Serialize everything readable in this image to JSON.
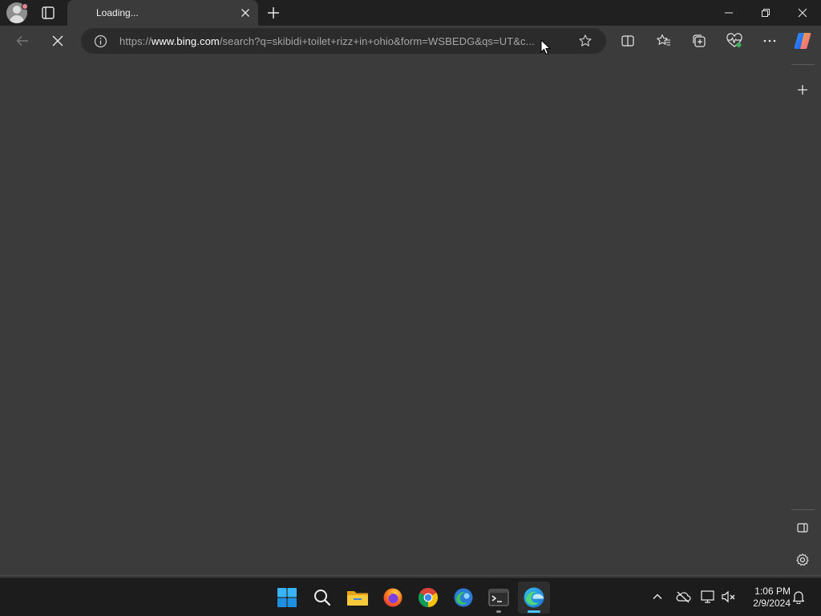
{
  "browser": {
    "tab": {
      "title": "Loading...",
      "close_icon": "close-icon"
    },
    "profile_icon": "avatar-icon",
    "window_controls": {
      "minimize": "minimize-icon",
      "restore": "restore-icon",
      "close": "close-icon"
    },
    "address": {
      "scheme": "https://",
      "host": "www.bing.com",
      "path": "/search?q=skibidi+toilet+rizz+in+ohio&form=WSBEDG&qs=UT&c..."
    },
    "toolbar_icons": [
      "back-icon",
      "stop-loading-icon",
      "site-info-icon",
      "favorite-star-icon",
      "split-screen-icon",
      "favorites-icon",
      "collections-icon",
      "browser-essentials-icon",
      "more-options-icon",
      "copilot-icon"
    ],
    "sidebar_icons": [
      "add-icon",
      "hide-sidebar-icon",
      "settings-icon"
    ]
  },
  "taskbar": {
    "apps": [
      "start-icon",
      "search-icon",
      "file-explorer-icon",
      "firefox-icon",
      "chrome-icon",
      "edge-dev-icon",
      "terminal-icon",
      "edge-icon"
    ],
    "tray_icons": [
      "show-hidden-icons-icon",
      "onedrive-icon",
      "network-icon",
      "volume-muted-icon",
      "notifications-icon"
    ],
    "clock": {
      "time": "1:06 PM",
      "date": "2/9/2024"
    }
  },
  "colors": {
    "accent": "#4cc2ff",
    "content_bg": "#3b3b3b",
    "taskbar_bg": "#1c1c1c"
  }
}
